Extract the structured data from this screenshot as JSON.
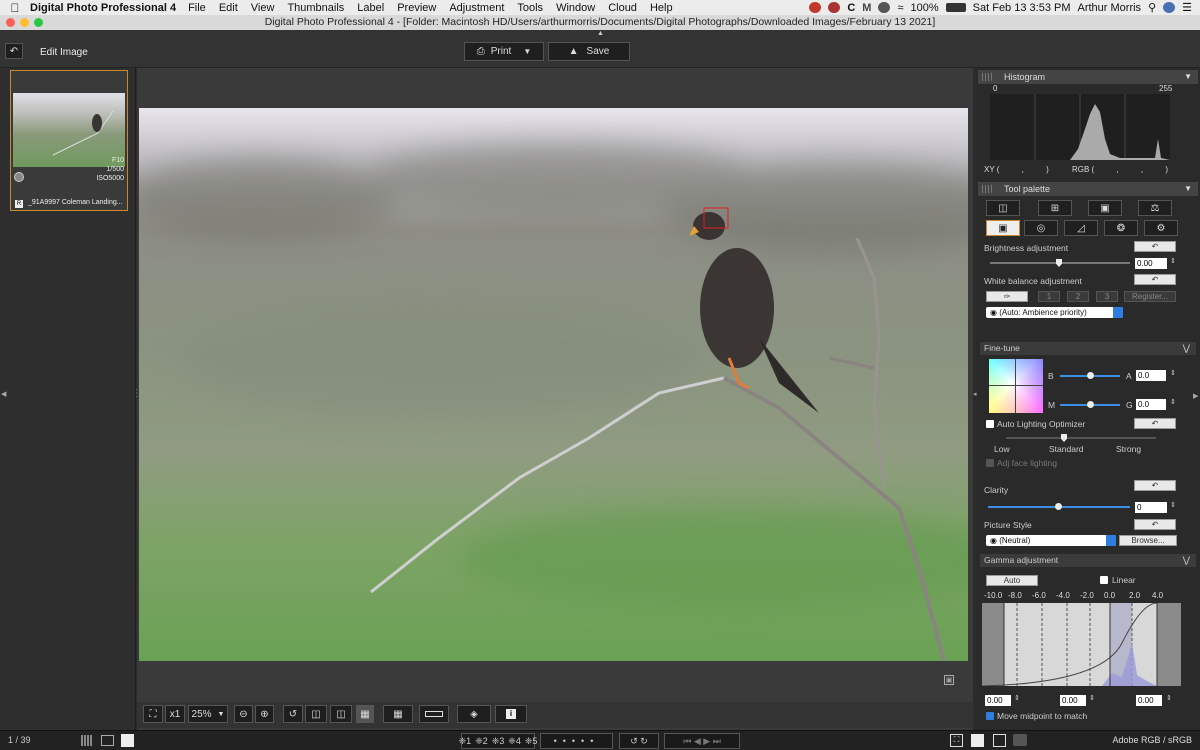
{
  "menubar": {
    "app_name": "Digital Photo Professional 4",
    "items": [
      "File",
      "Edit",
      "View",
      "Thumbnails",
      "Label",
      "Preview",
      "Adjustment",
      "Tools",
      "Window",
      "Cloud",
      "Help"
    ],
    "battery": "100%",
    "clock": "Sat Feb 13  3:53 PM",
    "user": "Arthur Morris"
  },
  "window": {
    "title": "Digital Photo Professional 4 - [Folder: Macintosh HD/Users/arthurmorris/Documents/Digital Photographs/Downloaded Images/February 13 2021]"
  },
  "toolbar": {
    "title": "Edit Image",
    "print_label": "Print",
    "save_label": "Save"
  },
  "thumbnail": {
    "aperture": "F10",
    "shutter": "1/500",
    "iso": "ISO5000",
    "raw_badge": "R",
    "filename": "_91A9997  Coleman Landing..."
  },
  "viewbar": {
    "zoom_x": "x1",
    "zoom": "25%"
  },
  "histogram": {
    "title": "Histogram",
    "min_label": "0",
    "max_label": "255",
    "xy_label": "XY (          ,          )",
    "rgb_label": "RGB (          ,          ,          )"
  },
  "tool_palette": {
    "title": "Tool palette",
    "brightness_label": "Brightness adjustment",
    "brightness_value": "0.00",
    "wb_label": "White balance adjustment",
    "wb_buttons": [
      "1",
      "2",
      "3"
    ],
    "register_label": "Register...",
    "wb_select": "(Auto: Ambience priority)",
    "finetune_title": "Fine-tune",
    "b_label": "B",
    "a_label": "A",
    "m_label": "M",
    "g_label": "G",
    "ba_value": "0.0",
    "mg_value": "0.0",
    "alo_label": "Auto Lighting Optimizer",
    "alo_low": "Low",
    "alo_standard": "Standard",
    "alo_strong": "Strong",
    "face_label": "Adj face lighting",
    "clarity_label": "Clarity",
    "clarity_value": "0",
    "picture_style_label": "Picture Style",
    "picture_style_select": "(Neutral)",
    "browse_label": "Browse...",
    "gamma_title": "Gamma adjustment",
    "auto_label": "Auto",
    "linear_label": "Linear",
    "gamma_ticks": [
      "-10.0",
      "-8.0",
      "-6.0",
      "-4.0",
      "-2.0",
      "0.0",
      "2.0",
      "4.0"
    ],
    "gamma_left": "0.00",
    "gamma_mid": "0.00",
    "gamma_right": "0.00",
    "midpoint_label": "Move midpoint to match"
  },
  "status": {
    "counter": "1 / 39",
    "stars": [
      "❈1",
      "❈2",
      "❈3",
      "❈4",
      "❈5"
    ],
    "colorspace": "Adobe RGB / sRGB"
  },
  "colors": {
    "accent": "#c88a2a",
    "select_blue": "#2f7de1"
  }
}
